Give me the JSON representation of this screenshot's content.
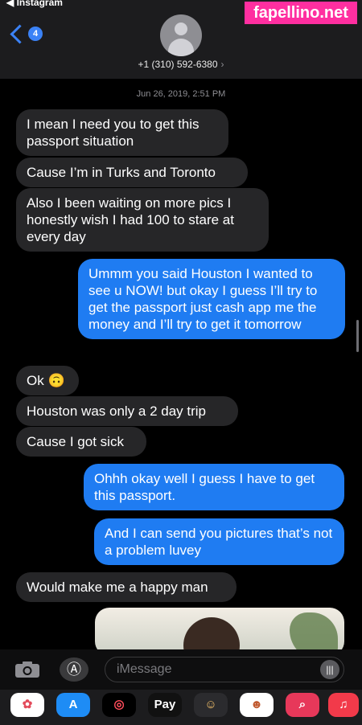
{
  "status": {
    "back_app": "◀ Instagram"
  },
  "header": {
    "back_count": "4",
    "phone": "+1 (310) 592-6380",
    "phone_chevron": "›"
  },
  "timestamp": "Jun 26, 2019, 2:51 PM",
  "messages": [
    {
      "dir": "in",
      "text": "I mean I need you to get this passport situation"
    },
    {
      "dir": "in",
      "text": "Cause I’m in Turks and Toronto"
    },
    {
      "dir": "in",
      "text": "Also I been waiting on more pics I honestly wish I had 100 to stare at every day"
    },
    {
      "dir": "out",
      "text": "Ummm you said Houston I wanted to see u NOW! but okay I guess I’ll try to get the passport just cash app me the money and I’ll try to get it tomorrow"
    },
    {
      "dir": "in",
      "text": "Ok 🙃"
    },
    {
      "dir": "in",
      "text": "Houston was only a 2 day trip"
    },
    {
      "dir": "in",
      "text": "Cause I got sick"
    },
    {
      "dir": "out",
      "text": "Ohhh okay well I guess I have to get this passport."
    },
    {
      "dir": "out",
      "text": "And I can send you pictures that’s not a problem luvey"
    },
    {
      "dir": "in",
      "text": "Would make me a happy man"
    }
  ],
  "input": {
    "placeholder": "iMessage"
  },
  "icons": {
    "camera": "camera-icon",
    "appstore": "app-store-icon",
    "audio": "audio-waveform-icon"
  },
  "app_drawer": [
    {
      "name": "photos",
      "label": "✿",
      "bg": "#ffffff",
      "fg": "#e34b5b"
    },
    {
      "name": "app-store",
      "label": "A",
      "bg": "#1e8cf5",
      "fg": "#ffffff"
    },
    {
      "name": "activity",
      "label": "◎",
      "bg": "#000000",
      "fg": "#ff4d5b"
    },
    {
      "name": "apple-pay",
      "label": "Pay",
      "bg": "#111111",
      "fg": "#ffffff"
    },
    {
      "name": "memoji",
      "label": "☺",
      "bg": "#2b2b2e",
      "fg": "#f5c26b"
    },
    {
      "name": "animoji",
      "label": "☻",
      "bg": "#ffffff",
      "fg": "#c0592f"
    },
    {
      "name": "search-images",
      "label": "⌕",
      "bg": "#e7385a",
      "fg": "#ffffff"
    },
    {
      "name": "music",
      "label": "♫",
      "bg": "#f23a4a",
      "fg": "#ffffff"
    }
  ],
  "watermark": "fapellino.net",
  "colors": {
    "incoming": "#262628",
    "outgoing": "#1f7cf2",
    "accent": "#3b82f6"
  }
}
